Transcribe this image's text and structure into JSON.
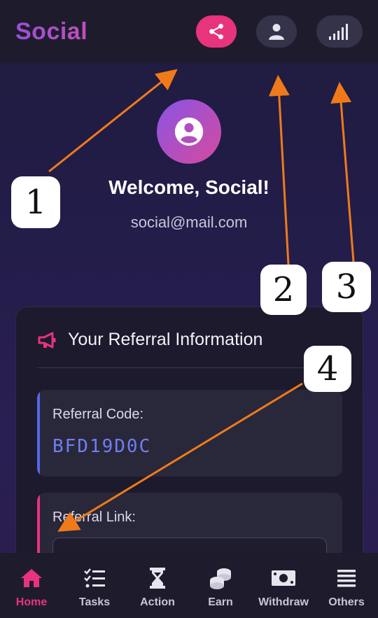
{
  "header": {
    "brand": "Social",
    "share_icon": "share-icon",
    "profile_icon": "user-icon",
    "signal_icon": "signal-icon",
    "share_color": "#e8337d"
  },
  "profile": {
    "welcome": "Welcome, Social!",
    "email": "social@mail.com",
    "avatar_icon": "user-circle-icon"
  },
  "referral": {
    "title": "Your Referral Information",
    "title_icon": "megaphone-icon",
    "code_label": "Referral Code:",
    "code_value": "BFD19D0C",
    "link_label": "Referral Link:",
    "link_value": ""
  },
  "nav": {
    "items": [
      {
        "label": "Home",
        "icon": "home-icon",
        "active": true
      },
      {
        "label": "Tasks",
        "icon": "tasks-icon",
        "active": false
      },
      {
        "label": "Action",
        "icon": "hourglass-icon",
        "active": false
      },
      {
        "label": "Earn",
        "icon": "coins-icon",
        "active": false
      },
      {
        "label": "Withdraw",
        "icon": "money-icon",
        "active": false
      },
      {
        "label": "Others",
        "icon": "menu-icon",
        "active": false
      }
    ]
  },
  "annotations": {
    "one": "1",
    "two": "2",
    "three": "3",
    "four": "4"
  },
  "colors": {
    "accent_pink": "#e8337d",
    "accent_blue": "#5568e8",
    "annotation_arrow": "#f07a1a"
  }
}
